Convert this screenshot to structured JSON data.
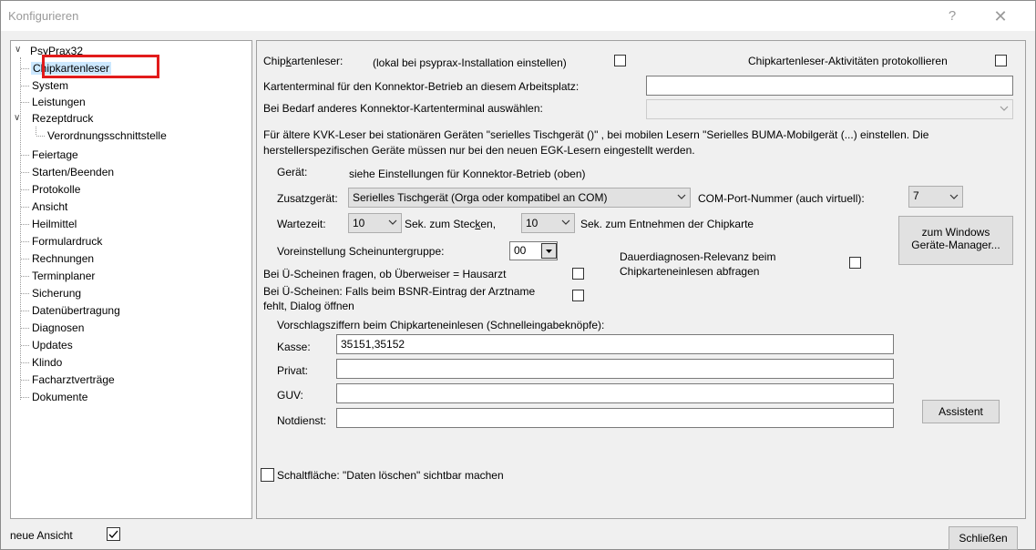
{
  "window": {
    "title": "Konfigurieren",
    "help_glyph": "?",
    "close_glyph": "✕"
  },
  "tree": {
    "root": "PsyPrax32",
    "items": [
      "Chipkartenleser",
      "System",
      "Leistungen",
      "Rezeptdruck",
      "Verordnungsschnittstelle",
      "Feiertage",
      "Starten/Beenden",
      "Protokolle",
      "Ansicht",
      "Heilmittel",
      "Formulardruck",
      "Rechnungen",
      "Terminplaner",
      "Sicherung",
      "Datenübertragung",
      "Diagnosen",
      "Updates",
      "Klindo",
      "Facharztverträge",
      "Dokumente"
    ]
  },
  "main": {
    "chip_label_pre": "Chip",
    "chip_label_u": "k",
    "chip_label_post": "artenleser:",
    "chip_note": "(lokal bei psyprax-Installation einstellen)",
    "chip_log_label": "Chipkartenleser-Aktivitäten protokollieren",
    "terminal_label": "Kartenterminal für den Konnektor-Betrieb an diesem Arbeitsplatz:",
    "terminal_value": "",
    "other_terminal_label": "Bei Bedarf anderes Konnektor-Kartenterminal auswählen:",
    "other_terminal_value": "",
    "info_line1": "Für ältere KVK-Leser bei stationären Geräten \"serielles Tischgerät ()\" , bei mobilen Lesern \"Serielles BUMA-Mobilgerät (...) einstellen. Die",
    "info_line2": "herstellerspezifischen Geräte müssen nur bei den neuen EGK-Lesern eingestellt werden.",
    "geraet_label": "Gerät:",
    "geraet_value": "siehe Einstellungen für Konnektor-Betrieb (oben)",
    "zusatz_label": "Zusatzgerät:",
    "zusatz_value": "Serielles Tischgerät (Orga oder kompatibel an COM)",
    "com_label": "COM-Port-Nummer (auch virtuell):",
    "com_value": "7",
    "wartezeit_label": "Wartezeit:",
    "wait_insert_value": "10",
    "wait_insert_label_pre": "Sek. zum Stec",
    "wait_insert_label_u": "k",
    "wait_insert_label_post": "en,",
    "wait_remove_value": "10",
    "wait_remove_label": "Sek. zum Entnehmen der Chipkarte",
    "device_manager_line1": "zum Windows",
    "device_manager_line2": "Geräte-Manager...",
    "voreinstellung_label": "Voreinstellung Scheinuntergruppe:",
    "voreinstellung_value": "00",
    "dauer_line1": "Dauerdiagnosen-Relevanz beim",
    "dauer_line2": "Chipkarteneinlesen abfragen",
    "ue_hausarzt_label": "Bei Ü-Scheinen fragen, ob Überweiser = Hausarzt",
    "ue_bsnr_line1": "Bei Ü-Scheinen: Falls beim BSNR-Eintrag der Arztname",
    "ue_bsnr_line2": "fehlt, Dialog öffnen",
    "vorschlag_label": "Vorschlagsziffern beim Chipkarteneinlesen (Schnelleingabeknöpfe):",
    "kasse_label": "Kasse:",
    "kasse_value": "35151,35152",
    "privat_label": "Privat:",
    "privat_value": "",
    "guv_label": "GUV:",
    "guv_value": "",
    "notdienst_label": "Notdienst:",
    "notdienst_value": "",
    "assistent_label": "Assistent",
    "delete_label": "Schaltfläche: \"Daten löschen\" sichtbar machen"
  },
  "footer": {
    "neue_ansicht_label": "neue Ansicht",
    "neue_ansicht_checked": true,
    "close_label": "Schließen"
  }
}
